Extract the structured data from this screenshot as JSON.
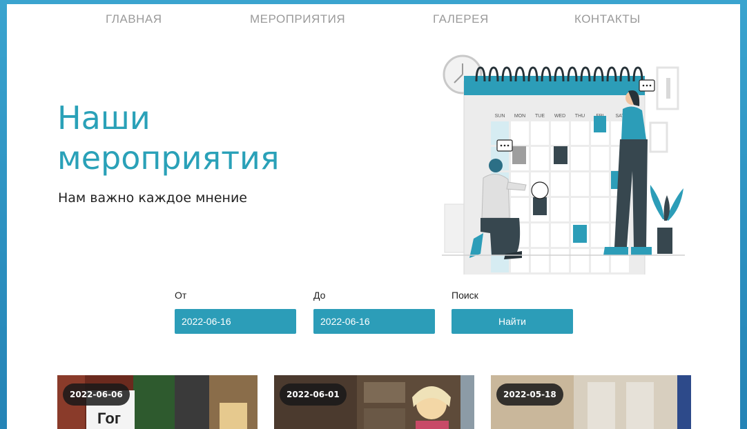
{
  "nav": {
    "home": "ГЛАВНАЯ",
    "events": "МЕРОПРИЯТИЯ",
    "gallery": "ГАЛЕРЕЯ",
    "contacts": "КОНТАКТЫ"
  },
  "hero": {
    "title_line1": "Наши",
    "title_line2": "мероприятия",
    "subtitle": "Нам важно каждое мнение"
  },
  "calendar_days": [
    "SUN",
    "MON",
    "TUE",
    "WED",
    "THU",
    "FRI",
    "SAT"
  ],
  "search": {
    "from_label": "От",
    "from_value": "2022-06-16",
    "to_label": "До",
    "to_value": "2022-06-16",
    "search_label": "Поиск",
    "button_label": "Найти"
  },
  "events": [
    {
      "date": "2022-06-06",
      "poster_text": "Гог"
    },
    {
      "date": "2022-06-01"
    },
    {
      "date": "2022-05-18"
    }
  ],
  "colors": {
    "accent": "#2c9db8",
    "title": "#2aa1b8",
    "frame": "#3aa4cf"
  }
}
